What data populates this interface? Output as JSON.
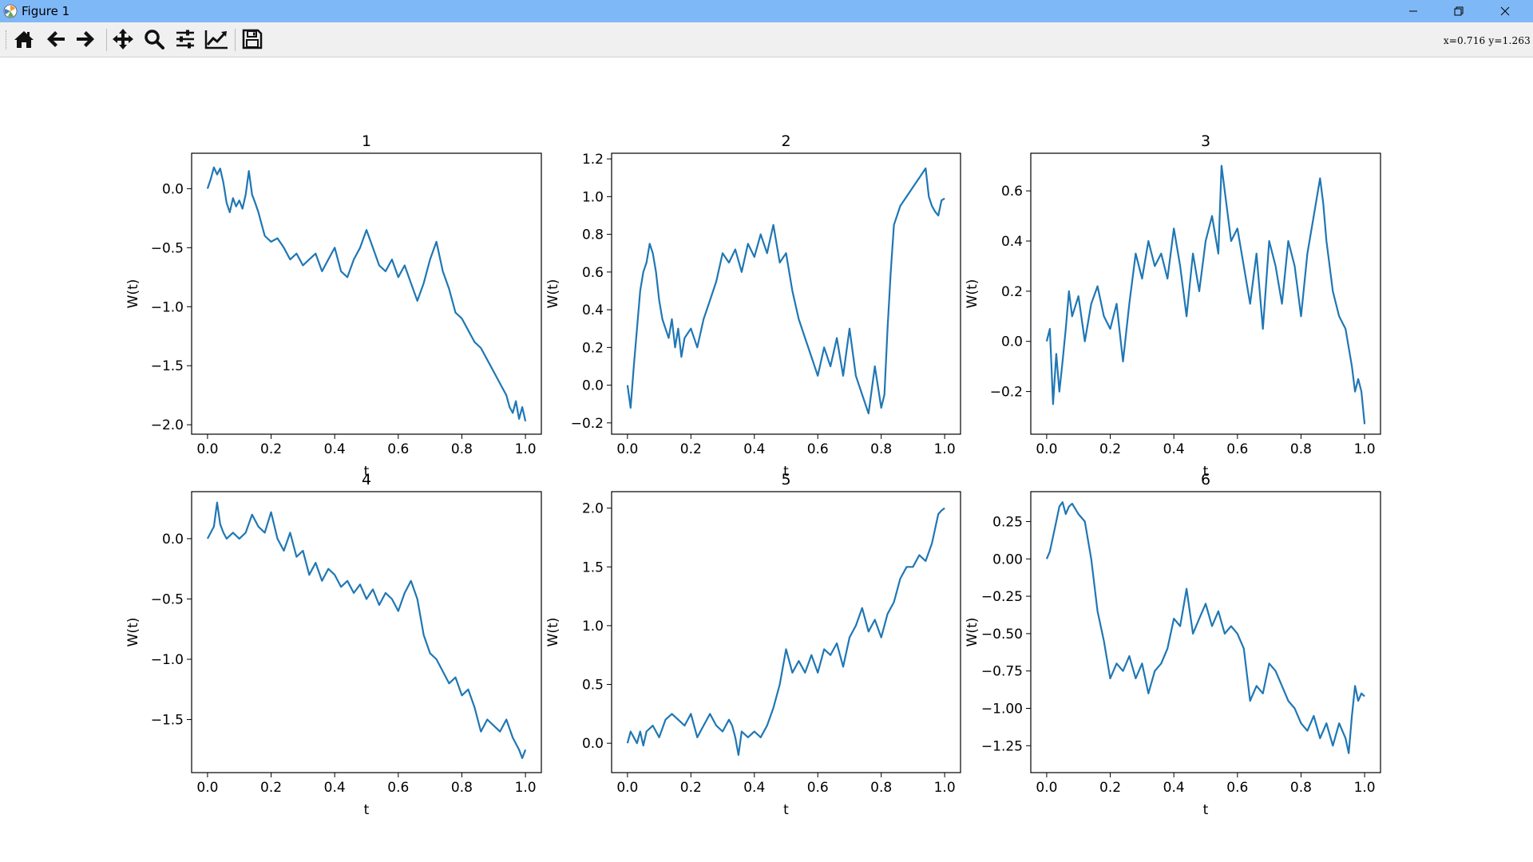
{
  "window": {
    "title": "Figure 1",
    "controls": [
      "minimize",
      "restore",
      "close"
    ]
  },
  "toolbar": {
    "buttons": [
      {
        "name": "home",
        "icon": "home-icon"
      },
      {
        "name": "back",
        "icon": "arrow-left-icon"
      },
      {
        "name": "forward",
        "icon": "arrow-right-icon"
      },
      {
        "name": "pan",
        "icon": "move-icon"
      },
      {
        "name": "zoom",
        "icon": "magnifier-icon"
      },
      {
        "name": "configure-subplots",
        "icon": "sliders-icon"
      },
      {
        "name": "edit-axes",
        "icon": "line-chart-icon"
      },
      {
        "name": "save",
        "icon": "floppy-disk-icon"
      }
    ],
    "coords": "x=0.716  y=1.263"
  },
  "colors": {
    "line": "#1f77b4",
    "titlebar": "#7fb8f7",
    "toolbar": "#f0f0f0"
  },
  "chart_data": [
    {
      "type": "line",
      "title": "1",
      "xlabel": "t",
      "ylabel": "W(t)",
      "xlim": [
        -0.05,
        1.05
      ],
      "ylim": [
        -2.08,
        0.3
      ],
      "xticks": [
        0.0,
        0.2,
        0.4,
        0.6,
        0.8,
        1.0
      ],
      "xticklabels": [
        "0.0",
        "0.2",
        "0.4",
        "0.6",
        "0.8",
        "1.0"
      ],
      "yticks": [
        0.0,
        -0.5,
        -1.0,
        -1.5,
        -2.0
      ],
      "yticklabels": [
        "0.0",
        "−0.5",
        "−1.0",
        "−1.5",
        "−2.0"
      ],
      "series": [
        {
          "x": [
            0,
            0.01,
            0.02,
            0.03,
            0.04,
            0.05,
            0.06,
            0.07,
            0.08,
            0.09,
            0.1,
            0.11,
            0.12,
            0.13,
            0.14,
            0.15,
            0.16,
            0.17,
            0.18,
            0.2,
            0.22,
            0.24,
            0.26,
            0.28,
            0.3,
            0.32,
            0.34,
            0.36,
            0.38,
            0.4,
            0.42,
            0.44,
            0.46,
            0.48,
            0.5,
            0.52,
            0.54,
            0.56,
            0.58,
            0.6,
            0.62,
            0.64,
            0.66,
            0.68,
            0.7,
            0.72,
            0.74,
            0.76,
            0.78,
            0.8,
            0.82,
            0.84,
            0.86,
            0.88,
            0.9,
            0.92,
            0.94,
            0.95,
            0.96,
            0.97,
            0.98,
            0.99,
            1.0
          ],
          "y": [
            0,
            0.08,
            0.18,
            0.12,
            0.17,
            0.05,
            -0.12,
            -0.2,
            -0.08,
            -0.15,
            -0.1,
            -0.17,
            -0.05,
            0.15,
            -0.05,
            -0.12,
            -0.2,
            -0.3,
            -0.4,
            -0.45,
            -0.42,
            -0.5,
            -0.6,
            -0.55,
            -0.65,
            -0.6,
            -0.55,
            -0.7,
            -0.6,
            -0.5,
            -0.7,
            -0.75,
            -0.6,
            -0.5,
            -0.35,
            -0.5,
            -0.65,
            -0.7,
            -0.6,
            -0.75,
            -0.65,
            -0.8,
            -0.95,
            -0.8,
            -0.6,
            -0.45,
            -0.7,
            -0.85,
            -1.05,
            -1.1,
            -1.2,
            -1.3,
            -1.35,
            -1.45,
            -1.55,
            -1.65,
            -1.75,
            -1.85,
            -1.9,
            -1.8,
            -1.95,
            -1.85,
            -1.97
          ]
        }
      ]
    },
    {
      "type": "line",
      "title": "2",
      "xlabel": "t",
      "ylabel": "W(t)",
      "xlim": [
        -0.05,
        1.05
      ],
      "ylim": [
        -0.26,
        1.23
      ],
      "xticks": [
        0.0,
        0.2,
        0.4,
        0.6,
        0.8,
        1.0
      ],
      "xticklabels": [
        "0.0",
        "0.2",
        "0.4",
        "0.6",
        "0.8",
        "1.0"
      ],
      "yticks": [
        -0.2,
        0.0,
        0.2,
        0.4,
        0.6,
        0.8,
        1.0,
        1.2
      ],
      "yticklabels": [
        "−0.2",
        "0.0",
        "0.2",
        "0.4",
        "0.6",
        "0.8",
        "1.0",
        "1.2"
      ],
      "series": [
        {
          "x": [
            0,
            0.01,
            0.02,
            0.03,
            0.04,
            0.05,
            0.06,
            0.07,
            0.08,
            0.09,
            0.1,
            0.11,
            0.12,
            0.13,
            0.14,
            0.15,
            0.16,
            0.17,
            0.18,
            0.2,
            0.22,
            0.24,
            0.26,
            0.28,
            0.3,
            0.32,
            0.34,
            0.36,
            0.38,
            0.4,
            0.42,
            0.44,
            0.46,
            0.48,
            0.5,
            0.52,
            0.54,
            0.56,
            0.58,
            0.6,
            0.62,
            0.64,
            0.66,
            0.68,
            0.7,
            0.72,
            0.74,
            0.76,
            0.78,
            0.8,
            0.81,
            0.82,
            0.83,
            0.84,
            0.86,
            0.88,
            0.9,
            0.92,
            0.94,
            0.95,
            0.96,
            0.97,
            0.98,
            0.99,
            1.0
          ],
          "y": [
            0,
            -0.12,
            0.1,
            0.3,
            0.5,
            0.6,
            0.65,
            0.75,
            0.7,
            0.6,
            0.45,
            0.35,
            0.3,
            0.25,
            0.35,
            0.2,
            0.3,
            0.15,
            0.25,
            0.3,
            0.2,
            0.35,
            0.45,
            0.55,
            0.7,
            0.65,
            0.72,
            0.6,
            0.75,
            0.68,
            0.8,
            0.7,
            0.85,
            0.65,
            0.7,
            0.5,
            0.35,
            0.25,
            0.15,
            0.05,
            0.2,
            0.1,
            0.25,
            0.05,
            0.3,
            0.05,
            -0.05,
            -0.15,
            0.1,
            -0.12,
            -0.05,
            0.3,
            0.6,
            0.85,
            0.95,
            1.0,
            1.05,
            1.1,
            1.15,
            1.0,
            0.95,
            0.92,
            0.9,
            0.98,
            0.99
          ]
        }
      ]
    },
    {
      "type": "line",
      "title": "3",
      "xlabel": "t",
      "ylabel": "W(t)",
      "xlim": [
        -0.05,
        1.05
      ],
      "ylim": [
        -0.37,
        0.75
      ],
      "xticks": [
        0.0,
        0.2,
        0.4,
        0.6,
        0.8,
        1.0
      ],
      "xticklabels": [
        "0.0",
        "0.2",
        "0.4",
        "0.6",
        "0.8",
        "1.0"
      ],
      "yticks": [
        -0.2,
        0.0,
        0.2,
        0.4,
        0.6
      ],
      "yticklabels": [
        "−0.2",
        "0.0",
        "0.2",
        "0.4",
        "0.6"
      ],
      "series": [
        {
          "x": [
            0,
            0.01,
            0.02,
            0.03,
            0.04,
            0.05,
            0.06,
            0.07,
            0.08,
            0.1,
            0.12,
            0.14,
            0.16,
            0.18,
            0.2,
            0.22,
            0.24,
            0.26,
            0.28,
            0.3,
            0.32,
            0.34,
            0.36,
            0.38,
            0.4,
            0.42,
            0.44,
            0.46,
            0.48,
            0.5,
            0.52,
            0.54,
            0.55,
            0.56,
            0.58,
            0.6,
            0.62,
            0.64,
            0.66,
            0.68,
            0.7,
            0.72,
            0.74,
            0.76,
            0.78,
            0.8,
            0.82,
            0.84,
            0.86,
            0.87,
            0.88,
            0.9,
            0.92,
            0.94,
            0.96,
            0.97,
            0.98,
            0.99,
            1.0
          ],
          "y": [
            0,
            0.05,
            -0.25,
            -0.05,
            -0.2,
            -0.08,
            0.05,
            0.2,
            0.1,
            0.18,
            0.0,
            0.15,
            0.22,
            0.1,
            0.05,
            0.15,
            -0.08,
            0.15,
            0.35,
            0.25,
            0.4,
            0.3,
            0.35,
            0.25,
            0.45,
            0.3,
            0.1,
            0.35,
            0.2,
            0.4,
            0.5,
            0.35,
            0.7,
            0.6,
            0.4,
            0.45,
            0.3,
            0.15,
            0.35,
            0.05,
            0.4,
            0.3,
            0.15,
            0.4,
            0.3,
            0.1,
            0.35,
            0.5,
            0.65,
            0.55,
            0.4,
            0.2,
            0.1,
            0.05,
            -0.1,
            -0.2,
            -0.15,
            -0.2,
            -0.33
          ]
        }
      ]
    },
    {
      "type": "line",
      "title": "4",
      "xlabel": "t",
      "ylabel": "W(t)",
      "xlim": [
        -0.05,
        1.05
      ],
      "ylim": [
        -1.94,
        0.39
      ],
      "xticks": [
        0.0,
        0.2,
        0.4,
        0.6,
        0.8,
        1.0
      ],
      "xticklabels": [
        "0.0",
        "0.2",
        "0.4",
        "0.6",
        "0.8",
        "1.0"
      ],
      "yticks": [
        0.0,
        -0.5,
        -1.0,
        -1.5
      ],
      "yticklabels": [
        "0.0",
        "−0.5",
        "−1.0",
        "−1.5"
      ],
      "series": [
        {
          "x": [
            0,
            0.01,
            0.02,
            0.03,
            0.04,
            0.05,
            0.06,
            0.08,
            0.1,
            0.12,
            0.14,
            0.16,
            0.18,
            0.2,
            0.22,
            0.24,
            0.26,
            0.28,
            0.3,
            0.32,
            0.34,
            0.36,
            0.38,
            0.4,
            0.42,
            0.44,
            0.46,
            0.48,
            0.5,
            0.52,
            0.54,
            0.56,
            0.58,
            0.6,
            0.62,
            0.64,
            0.66,
            0.68,
            0.7,
            0.72,
            0.74,
            0.76,
            0.78,
            0.8,
            0.82,
            0.84,
            0.86,
            0.88,
            0.9,
            0.92,
            0.94,
            0.96,
            0.98,
            0.99,
            1.0
          ],
          "y": [
            0,
            0.05,
            0.1,
            0.3,
            0.12,
            0.05,
            0.0,
            0.05,
            0.0,
            0.05,
            0.2,
            0.1,
            0.05,
            0.22,
            0.0,
            -0.1,
            0.05,
            -0.15,
            -0.1,
            -0.3,
            -0.2,
            -0.35,
            -0.25,
            -0.3,
            -0.4,
            -0.35,
            -0.45,
            -0.38,
            -0.5,
            -0.42,
            -0.55,
            -0.45,
            -0.5,
            -0.6,
            -0.45,
            -0.35,
            -0.5,
            -0.8,
            -0.95,
            -1.0,
            -1.1,
            -1.2,
            -1.15,
            -1.3,
            -1.25,
            -1.4,
            -1.6,
            -1.5,
            -1.55,
            -1.6,
            -1.5,
            -1.65,
            -1.75,
            -1.82,
            -1.75
          ]
        }
      ]
    },
    {
      "type": "line",
      "title": "5",
      "xlabel": "t",
      "ylabel": "W(t)",
      "xlim": [
        -0.05,
        1.05
      ],
      "ylim": [
        -0.25,
        2.14
      ],
      "xticks": [
        0.0,
        0.2,
        0.4,
        0.6,
        0.8,
        1.0
      ],
      "xticklabels": [
        "0.0",
        "0.2",
        "0.4",
        "0.6",
        "0.8",
        "1.0"
      ],
      "yticks": [
        0.0,
        0.5,
        1.0,
        1.5,
        2.0
      ],
      "yticklabels": [
        "0.0",
        "0.5",
        "1.0",
        "1.5",
        "2.0"
      ],
      "series": [
        {
          "x": [
            0,
            0.01,
            0.02,
            0.03,
            0.04,
            0.05,
            0.06,
            0.08,
            0.1,
            0.12,
            0.14,
            0.16,
            0.18,
            0.2,
            0.22,
            0.24,
            0.26,
            0.28,
            0.3,
            0.32,
            0.33,
            0.34,
            0.35,
            0.36,
            0.38,
            0.4,
            0.42,
            0.44,
            0.46,
            0.48,
            0.5,
            0.52,
            0.54,
            0.56,
            0.58,
            0.6,
            0.62,
            0.64,
            0.66,
            0.68,
            0.7,
            0.72,
            0.74,
            0.76,
            0.78,
            0.8,
            0.82,
            0.84,
            0.86,
            0.88,
            0.9,
            0.92,
            0.94,
            0.96,
            0.98,
            0.99,
            1.0
          ],
          "y": [
            0,
            0.1,
            0.05,
            0.0,
            0.1,
            -0.02,
            0.1,
            0.15,
            0.05,
            0.2,
            0.25,
            0.2,
            0.15,
            0.25,
            0.05,
            0.15,
            0.25,
            0.15,
            0.1,
            0.2,
            0.15,
            0.05,
            -0.1,
            0.1,
            0.05,
            0.1,
            0.05,
            0.15,
            0.3,
            0.5,
            0.8,
            0.6,
            0.7,
            0.6,
            0.75,
            0.6,
            0.8,
            0.75,
            0.85,
            0.65,
            0.9,
            1.0,
            1.15,
            0.95,
            1.05,
            0.9,
            1.1,
            1.2,
            1.4,
            1.5,
            1.5,
            1.6,
            1.55,
            1.7,
            1.95,
            1.98,
            2.0
          ]
        }
      ]
    },
    {
      "type": "line",
      "title": "6",
      "xlabel": "t",
      "ylabel": "W(t)",
      "xlim": [
        -0.05,
        1.05
      ],
      "ylim": [
        -1.43,
        0.45
      ],
      "xticks": [
        0.0,
        0.2,
        0.4,
        0.6,
        0.8,
        1.0
      ],
      "xticklabels": [
        "0.0",
        "0.2",
        "0.4",
        "0.6",
        "0.8",
        "1.0"
      ],
      "yticks": [
        0.25,
        0.0,
        -0.25,
        -0.5,
        -0.75,
        -1.0,
        -1.25
      ],
      "yticklabels": [
        "0.25",
        "0.00",
        "−0.25",
        "−0.50",
        "−0.75",
        "−1.00",
        "−1.25"
      ],
      "series": [
        {
          "x": [
            0,
            0.01,
            0.02,
            0.03,
            0.04,
            0.05,
            0.06,
            0.07,
            0.08,
            0.1,
            0.12,
            0.14,
            0.16,
            0.18,
            0.2,
            0.22,
            0.24,
            0.26,
            0.28,
            0.3,
            0.32,
            0.34,
            0.36,
            0.38,
            0.4,
            0.42,
            0.44,
            0.46,
            0.48,
            0.5,
            0.52,
            0.54,
            0.56,
            0.58,
            0.6,
            0.62,
            0.64,
            0.66,
            0.68,
            0.7,
            0.72,
            0.74,
            0.76,
            0.78,
            0.8,
            0.82,
            0.84,
            0.86,
            0.88,
            0.9,
            0.92,
            0.94,
            0.95,
            0.96,
            0.97,
            0.98,
            0.99,
            1.0
          ],
          "y": [
            0,
            0.05,
            0.15,
            0.25,
            0.35,
            0.38,
            0.3,
            0.35,
            0.37,
            0.3,
            0.25,
            0.0,
            -0.35,
            -0.55,
            -0.8,
            -0.7,
            -0.75,
            -0.65,
            -0.8,
            -0.7,
            -0.9,
            -0.75,
            -0.7,
            -0.6,
            -0.4,
            -0.45,
            -0.2,
            -0.5,
            -0.4,
            -0.3,
            -0.45,
            -0.35,
            -0.5,
            -0.45,
            -0.5,
            -0.6,
            -0.95,
            -0.85,
            -0.9,
            -0.7,
            -0.75,
            -0.85,
            -0.95,
            -1.0,
            -1.1,
            -1.15,
            -1.05,
            -1.2,
            -1.1,
            -1.25,
            -1.1,
            -1.2,
            -1.3,
            -1.05,
            -0.85,
            -0.95,
            -0.9,
            -0.92
          ]
        }
      ]
    }
  ]
}
